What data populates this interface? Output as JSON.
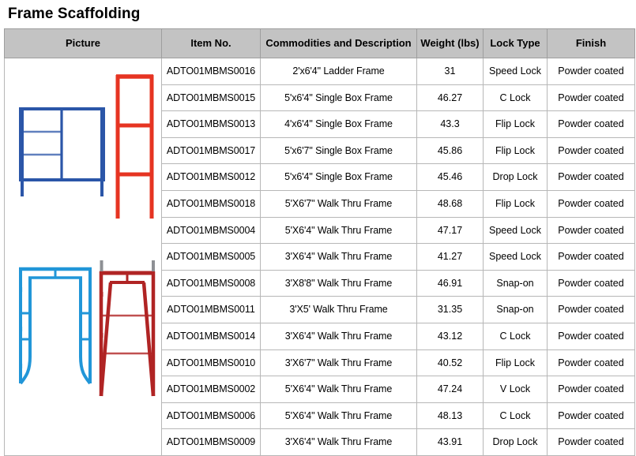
{
  "page": {
    "title": "Frame Scaffolding"
  },
  "table": {
    "headers": {
      "picture": "Picture",
      "item_no": "Item No.",
      "description": "Commodities and Description",
      "weight": "Weight  (lbs)",
      "lock_type": "Lock Type",
      "finish": "Finish"
    },
    "rows": [
      {
        "item_no": "ADTO01MBMS0016",
        "description": "2'x6'4\" Ladder Frame",
        "weight": "31",
        "lock_type": "Speed Lock",
        "finish": "Powder coated"
      },
      {
        "item_no": "ADTO01MBMS0015",
        "description": "5'x6'4\" Single Box Frame",
        "weight": "46.27",
        "lock_type": "C Lock",
        "finish": "Powder coated"
      },
      {
        "item_no": "ADTO01MBMS0013",
        "description": "4'x6'4\" Single Box Frame",
        "weight": "43.3",
        "lock_type": "Flip Lock",
        "finish": "Powder coated"
      },
      {
        "item_no": "ADTO01MBMS0017",
        "description": "5'x6'7\" Single Box Frame",
        "weight": "45.86",
        "lock_type": "Flip Lock",
        "finish": "Powder coated"
      },
      {
        "item_no": "ADTO01MBMS0012",
        "description": "5'x6'4\" Single Box Frame",
        "weight": "45.46",
        "lock_type": "Drop Lock",
        "finish": "Powder coated"
      },
      {
        "item_no": "ADTO01MBMS0018",
        "description": "5'X6'7\"  Walk Thru Frame",
        "weight": "48.68",
        "lock_type": "Flip Lock",
        "finish": "Powder coated"
      },
      {
        "item_no": "ADTO01MBMS0004",
        "description": "5'X6'4\"  Walk Thru Frame",
        "weight": "47.17",
        "lock_type": "Speed Lock",
        "finish": "Powder coated"
      },
      {
        "item_no": "ADTO01MBMS0005",
        "description": "3'X6'4\"  Walk Thru Frame",
        "weight": "41.27",
        "lock_type": "Speed Lock",
        "finish": "Powder coated"
      },
      {
        "item_no": "ADTO01MBMS0008",
        "description": "3'X8'8\" Walk Thru Frame",
        "weight": "46.91",
        "lock_type": "Snap-on",
        "finish": "Powder coated"
      },
      {
        "item_no": "ADTO01MBMS0011",
        "description": "3'X5'  Walk Thru Frame",
        "weight": "31.35",
        "lock_type": "Snap-on",
        "finish": "Powder coated"
      },
      {
        "item_no": "ADTO01MBMS0014",
        "description": "3'X6'4\"  Walk Thru Frame",
        "weight": "43.12",
        "lock_type": "C Lock",
        "finish": "Powder coated"
      },
      {
        "item_no": "ADTO01MBMS0010",
        "description": "3'X6'7\"  Walk Thru Frame",
        "weight": "40.52",
        "lock_type": "Flip Lock",
        "finish": "Powder coated"
      },
      {
        "item_no": "ADTO01MBMS0002",
        "description": "5'X6'4\"  Walk Thru Frame",
        "weight": "47.24",
        "lock_type": "V Lock",
        "finish": "Powder coated"
      },
      {
        "item_no": "ADTO01MBMS0006",
        "description": "5'X6'4\"  Walk Thru Frame",
        "weight": "48.13",
        "lock_type": "C Lock",
        "finish": "Powder coated"
      },
      {
        "item_no": "ADTO01MBMS0009",
        "description": "3'X6'4\"  Walk Thru Frame",
        "weight": "43.91",
        "lock_type": "Drop Lock",
        "finish": "Powder coated"
      }
    ]
  },
  "pictures": [
    {
      "name": "blue-ladder-frame-image",
      "color": "#2b56a8"
    },
    {
      "name": "red-ladder-frame-image",
      "color": "#e63422"
    },
    {
      "name": "light-blue-walk-thru-frame-image",
      "color": "#2196d8"
    },
    {
      "name": "dark-red-walk-thru-frame-image",
      "color": "#b02424"
    }
  ],
  "colors": {
    "header_background": "#c3c3c3",
    "border": "#b7b7b7",
    "text": "#000000"
  }
}
